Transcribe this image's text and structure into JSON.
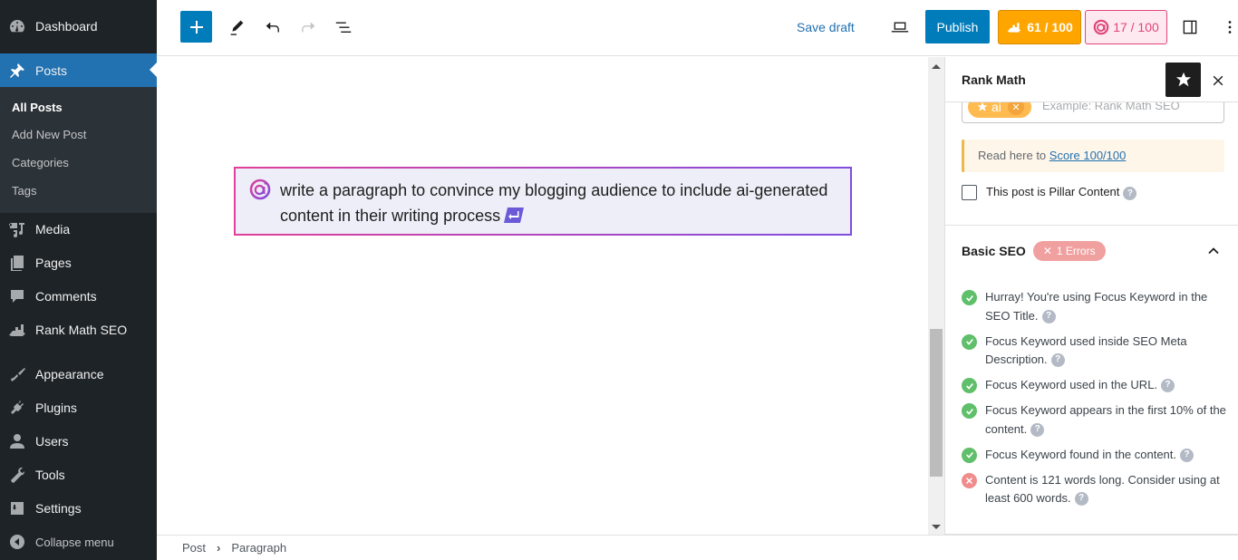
{
  "admin_menu": {
    "items": [
      {
        "label": "Dashboard",
        "icon": "dashboard-icon"
      },
      {
        "label": "Posts",
        "icon": "pin-icon",
        "current": true
      },
      {
        "label": "Media",
        "icon": "media-icon"
      },
      {
        "label": "Pages",
        "icon": "pages-icon"
      },
      {
        "label": "Comments",
        "icon": "comment-icon"
      },
      {
        "label": "Rank Math SEO",
        "icon": "rank-math-icon"
      },
      {
        "label": "Appearance",
        "icon": "brush-icon"
      },
      {
        "label": "Plugins",
        "icon": "plug-icon"
      },
      {
        "label": "Users",
        "icon": "user-icon"
      },
      {
        "label": "Tools",
        "icon": "wrench-icon"
      },
      {
        "label": "Settings",
        "icon": "settings-icon"
      }
    ],
    "submenu": [
      "All Posts",
      "Add New Post",
      "Categories",
      "Tags"
    ],
    "collapse_label": "Collapse menu"
  },
  "toolbar": {
    "save_draft": "Save draft",
    "publish": "Publish",
    "seo_score": "61 / 100",
    "ai_score": "17 / 100",
    "colors": {
      "primary": "#007cba",
      "seo_score_bg": "#ffa500",
      "ai_score_accent": "#e0457b"
    }
  },
  "editor": {
    "ai_prompt": "write a paragraph to convince my blogging audience to include ai-generated content in their writing process"
  },
  "panel": {
    "title": "Rank Math",
    "focus_keyword": "ai",
    "keyword_placeholder": "Example: Rank Math SEO",
    "notice_prefix": "Read here to ",
    "notice_link": "Score 100/100",
    "pillar_label": "This post is Pillar Content",
    "basic_seo": {
      "title": "Basic SEO",
      "error_badge": "1 Errors",
      "tests": [
        {
          "status": "pass",
          "text": "Hurray! You're using Focus Keyword in the SEO Title."
        },
        {
          "status": "pass",
          "text": "Focus Keyword used inside SEO Meta Description."
        },
        {
          "status": "pass",
          "text": "Focus Keyword used in the URL."
        },
        {
          "status": "pass",
          "text": "Focus Keyword appears in the first 10% of the content."
        },
        {
          "status": "pass",
          "text": "Focus Keyword found in the content."
        },
        {
          "status": "fail",
          "text": "Content is 121 words long. Consider using at least 600 words."
        }
      ]
    }
  },
  "footer": {
    "breadcrumb": [
      "Post",
      "Paragraph"
    ]
  }
}
